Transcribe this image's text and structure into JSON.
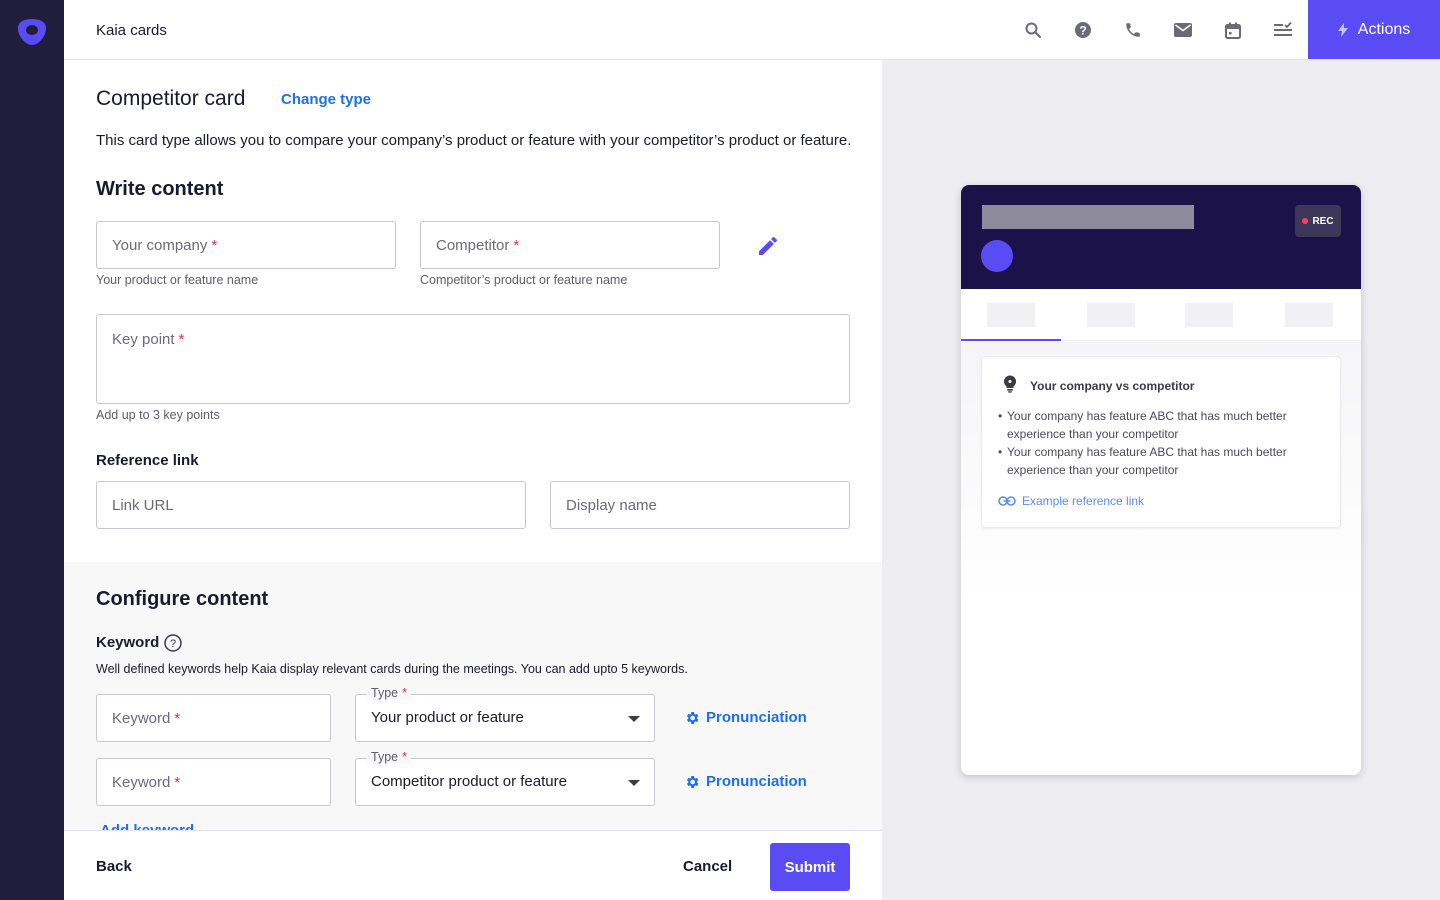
{
  "app": {
    "title": "Kaia cards",
    "actions_label": "Actions",
    "accent": "#5a4cf5",
    "link_color": "#1f6fe8"
  },
  "topbar": {
    "icons": [
      "search-icon",
      "help-icon",
      "phone-icon",
      "mail-icon",
      "calendar-icon",
      "checklist-icon"
    ]
  },
  "form": {
    "card_title": "Competitor card",
    "change_type": "Change type",
    "description": "This card type allows you to compare your company’s product or feature with your competitor’s product or feature.",
    "write_content": {
      "heading": "Write content",
      "your_company": {
        "placeholder": "Your company",
        "helper": "Your product or feature name"
      },
      "competitor": {
        "placeholder": "Competitor",
        "helper": "Competitor’s product or feature name"
      },
      "key_point": {
        "placeholder": "Key point",
        "helper": "Add up to 3 key points"
      },
      "reference_link": {
        "label": "Reference link",
        "url_placeholder": "Link URL",
        "display_placeholder": "Display name"
      }
    },
    "configure_content": {
      "heading": "Configure content",
      "keyword_label": "Keyword",
      "keyword_hint": "Well defined keywords help Kaia display relevant cards during the meetings. You can add upto 5 keywords.",
      "rows": [
        {
          "keyword_placeholder": "Keyword",
          "type_label": "Type",
          "type_value": "Your product or feature",
          "pronunciation": "Pronunciation"
        },
        {
          "keyword_placeholder": "Keyword",
          "type_label": "Type",
          "type_value": "Competitor product or feature",
          "pronunciation": "Pronunciation"
        }
      ],
      "add_keyword": "Add keyword"
    },
    "footer": {
      "back": "Back",
      "cancel": "Cancel",
      "submit": "Submit"
    }
  },
  "preview": {
    "rec_label": "REC",
    "card_title": "Your company vs competitor",
    "bullets": [
      "Your company has feature ABC that has much better experience than your competitor",
      "Your company has feature ABC that has much better experience than your competitor"
    ],
    "link_text": "Example reference link"
  }
}
